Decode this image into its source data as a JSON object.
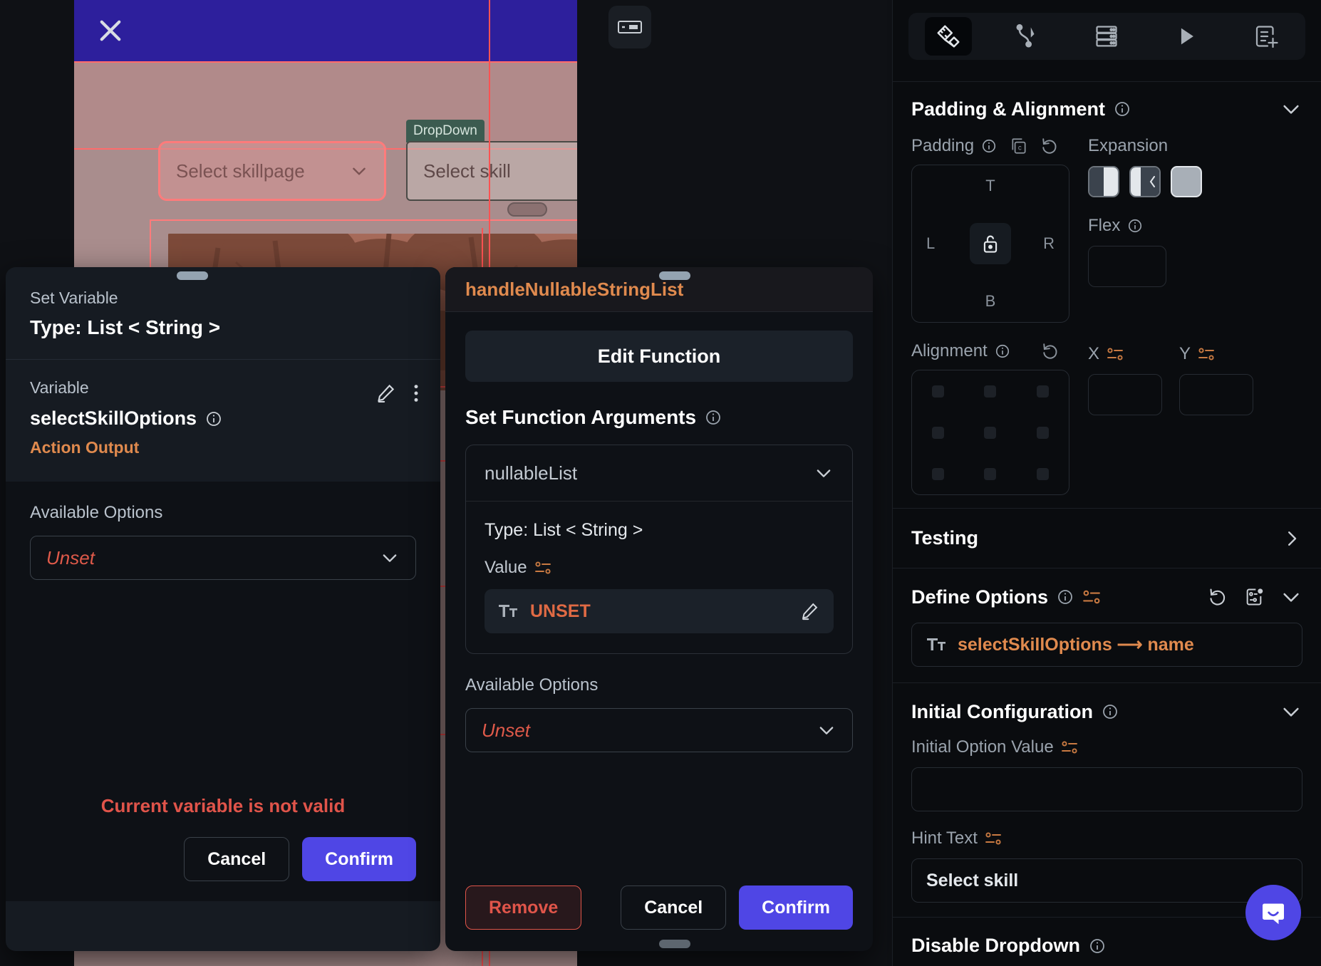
{
  "canvas": {
    "device": {
      "appbar": {
        "close_icon": "close-icon"
      },
      "dropdown_skillpage": {
        "label": "Select skillpage",
        "chevron": "chevron-down-icon"
      },
      "dropdown_skill": {
        "label": "Select skill",
        "chevron": "chevron-down-icon",
        "tag": "DropDown"
      },
      "image_alt": "forest-canopy-image"
    },
    "floating_widget_icon": "text-field-widget-icon"
  },
  "set_variable_dialog": {
    "subtitle": "Set Variable",
    "title": "Type: List < String >",
    "variable_label": "Variable",
    "variable_name": "selectSkillOptions",
    "variable_kind": "Action Output",
    "edit_icon": "pencil-icon",
    "more_icon": "more-vertical-icon",
    "info_icon": "info-icon",
    "available_options_label": "Available Options",
    "available_options_value": "Unset",
    "error": "Current variable is not valid",
    "cancel_label": "Cancel",
    "confirm_label": "Confirm"
  },
  "function_dialog": {
    "function_name": "handleNullableStringList",
    "edit_function_label": "Edit Function",
    "set_function_arguments_label": "Set Function Arguments",
    "argument_name": "nullableList",
    "argument_type": "Type: List < String >",
    "value_label": "Value",
    "value": "UNSET",
    "value_type_icon": "text-type-icon",
    "value_edit_icon": "pencil-icon",
    "available_options_label": "Available Options",
    "available_options_value": "Unset",
    "remove_label": "Remove",
    "cancel_label": "Cancel",
    "confirm_label": "Confirm"
  },
  "properties_panel": {
    "toolbar": [
      {
        "name": "design-tools-icon",
        "active": true
      },
      {
        "name": "actions-flow-icon",
        "active": false
      },
      {
        "name": "backend-query-icon",
        "active": false
      },
      {
        "name": "run-icon",
        "active": false
      },
      {
        "name": "add-component-icon",
        "active": false
      }
    ],
    "padding_alignment": {
      "title": "Padding & Alignment",
      "padding_label": "Padding",
      "padding_top": "T",
      "padding_bottom": "B",
      "padding_left": "L",
      "padding_right": "R",
      "lock_icon": "unlock-icon",
      "copy_icon": "copy-icon",
      "reset_icon": "reset-icon",
      "expansion_label": "Expansion",
      "flex_label": "Flex",
      "alignment_label": "Alignment",
      "x_label": "X",
      "y_label": "Y",
      "collapse_icon": "chevron-down-icon"
    },
    "testing": {
      "title": "Testing",
      "chevron": "chevron-right-icon"
    },
    "define_options": {
      "title": "Define Options",
      "chip_text": "selectSkillOptions ⟶ name",
      "chip_icon": "text-type-icon",
      "reset_icon": "reset-icon",
      "variable_icon": "set-variable-icon",
      "collapse_icon": "chevron-down-icon"
    },
    "initial_configuration": {
      "title": "Initial Configuration",
      "initial_option_value_label": "Initial Option Value",
      "initial_option_value": "",
      "hint_text_label": "Hint Text",
      "hint_text_value": "Select skill",
      "collapse_icon": "chevron-down-icon"
    },
    "disable_dropdown": {
      "label": "Disable Dropdown",
      "info_icon": "info-icon"
    },
    "intercom_icon": "chat-bubble-icon"
  },
  "colors": {
    "accent": "#4f46e5",
    "danger": "#e0544a",
    "variable_orange": "#e08a4e",
    "panel_bg": "#0a0c0f",
    "dialog_bg": "#161b22"
  }
}
